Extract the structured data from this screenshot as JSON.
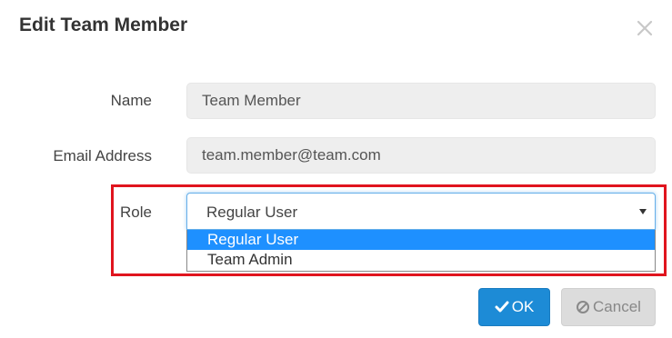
{
  "dialog": {
    "title": "Edit Team Member",
    "close_icon": "close-icon"
  },
  "form": {
    "name": {
      "label": "Name",
      "value": "Team Member"
    },
    "email": {
      "label": "Email Address",
      "value": "team.member@team.com"
    },
    "role": {
      "label": "Role",
      "selected": "Regular User",
      "options": [
        "Regular User",
        "Team Admin"
      ],
      "highlighted_option": "Regular User",
      "arrow_icon": "triangle-down-icon"
    }
  },
  "buttons": {
    "ok_label": "OK",
    "ok_icon": "check-icon",
    "cancel_label": "Cancel",
    "cancel_icon": "ban-icon"
  },
  "colors": {
    "primary": "#1d8bd6",
    "selected_option": "#1e90ff",
    "annotation_box": "#e0141e",
    "cancel_bg": "#dcdcdc"
  }
}
